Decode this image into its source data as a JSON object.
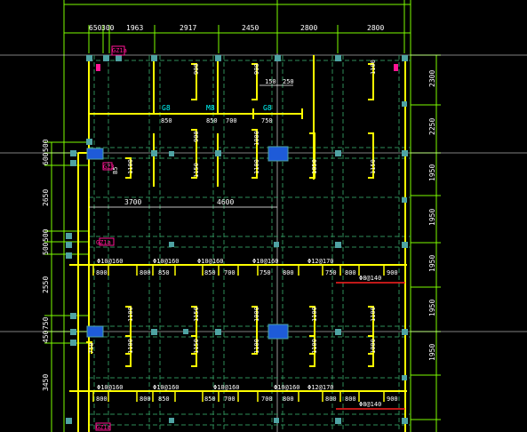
{
  "colors": {
    "background": "#000000",
    "dim": "#7CFC00",
    "grid": "#FFFFFF",
    "wall": "#FFFF00",
    "hidden": "#2E8B57",
    "column": "#4FA3A3",
    "tag": "#FF1493",
    "text": "#FFFFFF",
    "beamText": "#00FFFF",
    "red": "#FF2020",
    "block": "#1E5BD8"
  },
  "top_dims": [
    "650",
    "300",
    "1963",
    "2917",
    "2450",
    "2800",
    "2800"
  ],
  "right_dims": [
    "2300",
    "2250",
    "1950",
    "1950",
    "1950",
    "1950",
    "1950"
  ],
  "left_dims": [
    "500",
    "600",
    "2650",
    "500",
    "500",
    "2550",
    "750",
    "450",
    "3450"
  ],
  "span_dims": [
    "150",
    "250",
    "3700",
    "4600"
  ],
  "beam_labels": {
    "g1": "G8",
    "g2": "M8",
    "g3": "G8"
  },
  "wall_labels": [
    "900",
    "900",
    "850",
    "900",
    "700",
    "850",
    "1150",
    "1100",
    "1000",
    "1100",
    "1050",
    "1150",
    "1000",
    "1100",
    "750",
    "1100",
    "1100",
    "1150",
    "1000",
    "1100",
    "1100",
    "1150",
    "750",
    "1100",
    "1100"
  ],
  "slab_dims_row1": [
    "800",
    "800",
    "850",
    "850",
    "700",
    "750",
    "800",
    "750",
    "800",
    "900"
  ],
  "slab_dims_row2": [
    "800",
    "800",
    "850",
    "850",
    "700",
    "700",
    "800",
    "800",
    "800",
    "900"
  ],
  "rebar_row1": [
    "Φ10@160",
    "Φ10@160",
    "Φ10@160",
    "Φ10@160",
    "Φ12@170",
    "Φ8@140"
  ],
  "rebar_row2": [
    "Φ10@160",
    "Φ10@160",
    "Φ10@160",
    "Φ10@160",
    "Φ12@170",
    "Φ8@140"
  ],
  "tags": [
    "GZ1a",
    "GZ1a",
    "GZ1a",
    "GZ1a",
    "GZ3"
  ],
  "small_labels": [
    "B5",
    "B5",
    "750",
    "2"
  ]
}
